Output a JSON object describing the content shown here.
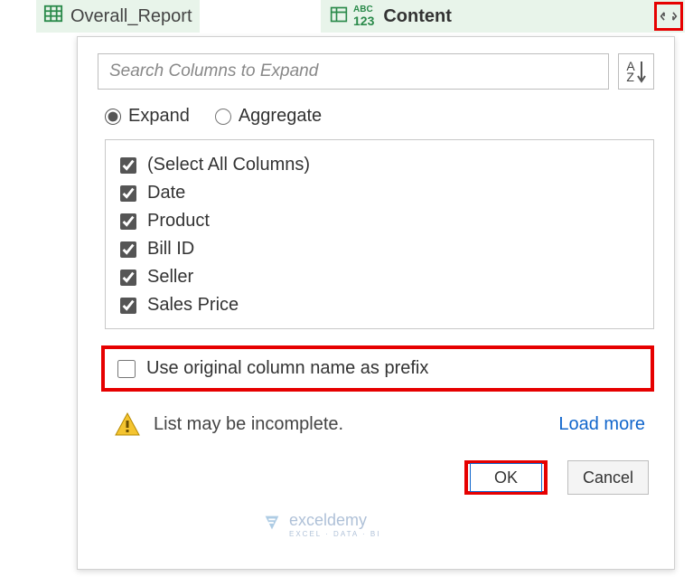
{
  "query": {
    "name": "Overall_Report"
  },
  "column_header": {
    "name": "Content"
  },
  "search": {
    "placeholder": "Search Columns to Expand"
  },
  "mode": {
    "expand_label": "Expand",
    "aggregate_label": "Aggregate",
    "selected": "expand"
  },
  "columns": {
    "select_all_label": "(Select All Columns)",
    "items": [
      {
        "label": "Date",
        "checked": true
      },
      {
        "label": "Product",
        "checked": true
      },
      {
        "label": "Bill ID",
        "checked": true
      },
      {
        "label": "Seller",
        "checked": true
      },
      {
        "label": "Sales Price",
        "checked": true
      }
    ]
  },
  "prefix": {
    "label": "Use original column name as prefix",
    "checked": false
  },
  "warning": {
    "text": "List may be incomplete.",
    "load_more_label": "Load more"
  },
  "buttons": {
    "ok": "OK",
    "cancel": "Cancel"
  },
  "watermark": {
    "brand": "exceldemy",
    "tagline": "EXCEL · DATA · BI"
  }
}
